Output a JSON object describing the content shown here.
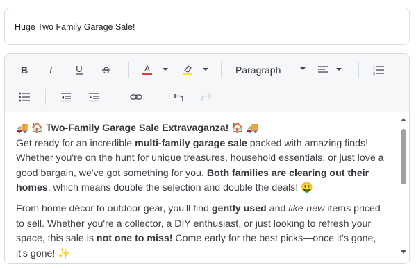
{
  "title_field": {
    "value": "Huge Two Family Garage Sale!"
  },
  "toolbar": {
    "icons": [
      "bold-icon",
      "italic-icon",
      "underline-icon",
      "strikethrough-icon",
      "text-color-icon",
      "highlight-color-icon",
      "align-left-icon",
      "numbered-list-icon",
      "bulleted-list-icon",
      "outdent-icon",
      "indent-icon",
      "link-icon",
      "undo-icon",
      "redo-icon"
    ],
    "format_select": "Paragraph",
    "text_color": "#e03a3a",
    "highlight_color": "#f5e43a"
  },
  "content": {
    "p1": {
      "heading_emoji_left": "🚚 🏠",
      "heading": "Two-Family Garage Sale Extravaganza!",
      "heading_emoji_right": "🏠 🚚",
      "t1": "Get ready for an incredible ",
      "b1": "multi-family garage sale",
      "t2": " packed with amazing finds! Whether you're on the hunt for unique treasures, household essentials, or just love a good bargain, we've got something for you. ",
      "b2": "Both families are clearing out their homes",
      "t3": ", which means double the selection and double the deals! ",
      "emoji": "🤑"
    },
    "p2": {
      "t1": "From home décor to outdoor gear, you'll find ",
      "b1": "gently used",
      "t2": " and ",
      "i1": "like-new",
      "t3": " items priced to sell. Whether you're a collector, a DIY enthusiast, or just looking to refresh your space, this sale is ",
      "b2": "not one to miss!",
      "t4": " Come early for the best picks—once it's gone, it's gone! ",
      "emoji": "✨"
    }
  }
}
